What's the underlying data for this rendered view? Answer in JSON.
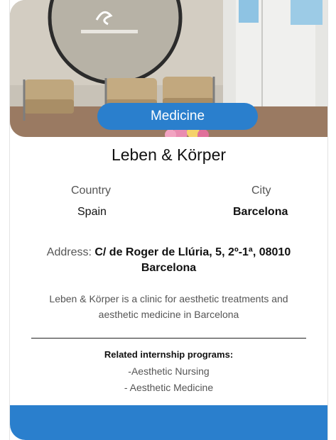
{
  "card": {
    "category_badge": "Medicine",
    "clinic_name": "Leben & Körper",
    "country_label": "Country",
    "country_value": "Spain",
    "city_label": "City",
    "city_value": "Barcelona",
    "address_label": "Address:",
    "address_value": "C/ de Roger de Llúria, 5, 2º-1ª, 08010 Barcelona",
    "description": "Leben & Körper is a clinic for aesthetic treatments and aesthetic medicine in Barcelona",
    "related_title": "Related internship programs:",
    "related_programs": [
      "-Aesthetic Nursing",
      "- Aesthetic Medicine"
    ]
  },
  "photo": {
    "subject": "clinic waiting room with round mirror, beige armchairs and flowers"
  },
  "colors": {
    "accent": "#2a7fcd",
    "text": "#111111",
    "muted": "#555555"
  }
}
